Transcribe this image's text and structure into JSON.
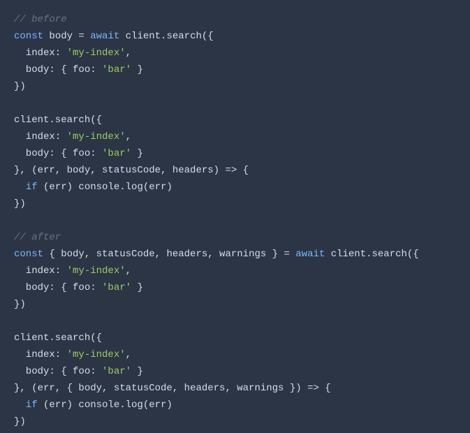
{
  "lines": [
    [
      {
        "cls": "comment",
        "text": "// before"
      }
    ],
    [
      {
        "cls": "keyword",
        "text": "const"
      },
      {
        "cls": "default",
        "text": " body = "
      },
      {
        "cls": "keyword",
        "text": "await"
      },
      {
        "cls": "default",
        "text": " client.search({"
      }
    ],
    [
      {
        "cls": "default",
        "text": "  index: "
      },
      {
        "cls": "str",
        "text": "'my-index'"
      },
      {
        "cls": "default",
        "text": ","
      }
    ],
    [
      {
        "cls": "default",
        "text": "  body: { foo: "
      },
      {
        "cls": "str",
        "text": "'bar'"
      },
      {
        "cls": "default",
        "text": " }"
      }
    ],
    [
      {
        "cls": "default",
        "text": "})"
      }
    ],
    [],
    [
      {
        "cls": "default",
        "text": "client.search({"
      }
    ],
    [
      {
        "cls": "default",
        "text": "  index: "
      },
      {
        "cls": "str",
        "text": "'my-index'"
      },
      {
        "cls": "default",
        "text": ","
      }
    ],
    [
      {
        "cls": "default",
        "text": "  body: { foo: "
      },
      {
        "cls": "str",
        "text": "'bar'"
      },
      {
        "cls": "default",
        "text": " }"
      }
    ],
    [
      {
        "cls": "default",
        "text": "}, (err, body, statusCode, headers) => {"
      }
    ],
    [
      {
        "cls": "default",
        "text": "  "
      },
      {
        "cls": "ctrl",
        "text": "if"
      },
      {
        "cls": "default",
        "text": " (err) console.log(err)"
      }
    ],
    [
      {
        "cls": "default",
        "text": "})"
      }
    ],
    [],
    [
      {
        "cls": "comment",
        "text": "// after"
      }
    ],
    [
      {
        "cls": "keyword",
        "text": "const"
      },
      {
        "cls": "default",
        "text": " { body, statusCode, headers, warnings } = "
      },
      {
        "cls": "keyword",
        "text": "await"
      },
      {
        "cls": "default",
        "text": " client.search({"
      }
    ],
    [
      {
        "cls": "default",
        "text": "  index: "
      },
      {
        "cls": "str",
        "text": "'my-index'"
      },
      {
        "cls": "default",
        "text": ","
      }
    ],
    [
      {
        "cls": "default",
        "text": "  body: { foo: "
      },
      {
        "cls": "str",
        "text": "'bar'"
      },
      {
        "cls": "default",
        "text": " }"
      }
    ],
    [
      {
        "cls": "default",
        "text": "})"
      }
    ],
    [],
    [
      {
        "cls": "default",
        "text": "client.search({"
      }
    ],
    [
      {
        "cls": "default",
        "text": "  index: "
      },
      {
        "cls": "str",
        "text": "'my-index'"
      },
      {
        "cls": "default",
        "text": ","
      }
    ],
    [
      {
        "cls": "default",
        "text": "  body: { foo: "
      },
      {
        "cls": "str",
        "text": "'bar'"
      },
      {
        "cls": "default",
        "text": " }"
      }
    ],
    [
      {
        "cls": "default",
        "text": "}, (err, { body, statusCode, headers, warnings }) => {"
      }
    ],
    [
      {
        "cls": "default",
        "text": "  "
      },
      {
        "cls": "ctrl",
        "text": "if"
      },
      {
        "cls": "default",
        "text": " (err) console.log(err)"
      }
    ],
    [
      {
        "cls": "default",
        "text": "})"
      }
    ]
  ]
}
